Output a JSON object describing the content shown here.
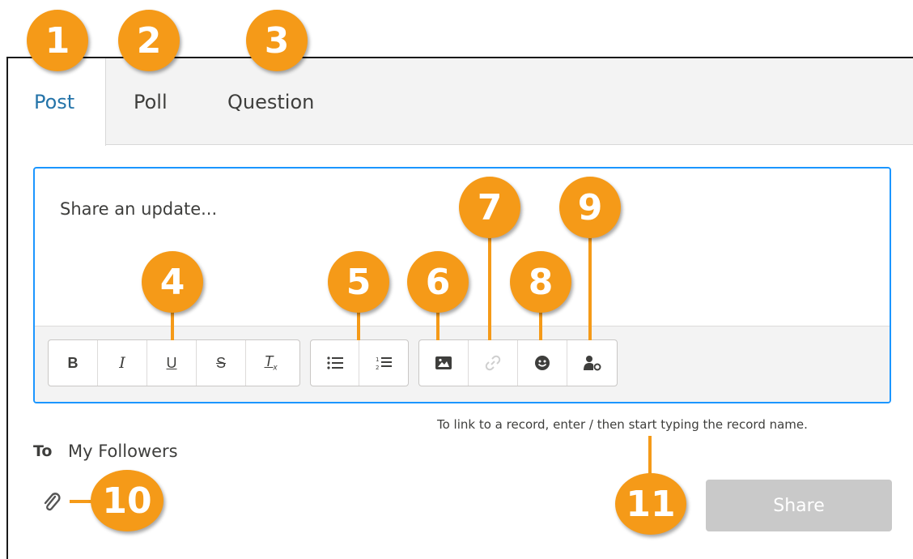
{
  "tabs": [
    {
      "label": "Post",
      "active": true
    },
    {
      "label": "Poll",
      "active": false
    },
    {
      "label": "Question",
      "active": false
    }
  ],
  "editor": {
    "placeholder": "Share an update..."
  },
  "toolbar": {
    "groups": [
      [
        {
          "icon": "bold-icon",
          "glyph": "B"
        },
        {
          "icon": "italic-icon",
          "glyph": "I"
        },
        {
          "icon": "underline-icon",
          "glyph": "U"
        },
        {
          "icon": "strikethrough-icon",
          "glyph": "S"
        },
        {
          "icon": "clear-formatting-icon",
          "glyph": "T"
        }
      ],
      [
        {
          "icon": "bulleted-list-icon"
        },
        {
          "icon": "numbered-list-icon"
        }
      ],
      [
        {
          "icon": "image-icon"
        },
        {
          "icon": "link-icon"
        },
        {
          "icon": "emoji-icon"
        },
        {
          "icon": "mention-icon"
        }
      ]
    ]
  },
  "hint": "To link to a record, enter / then start typing the record name.",
  "to": {
    "label": "To",
    "value": "My Followers"
  },
  "share_button": "Share",
  "callouts": [
    "1",
    "2",
    "3",
    "4",
    "5",
    "6",
    "7",
    "8",
    "9",
    "10",
    "11"
  ],
  "colors": {
    "accent": "#f59a18",
    "focus_border": "#1b96ff",
    "active_tab": "#2574a9",
    "disabled_button": "#c9c9c9"
  }
}
